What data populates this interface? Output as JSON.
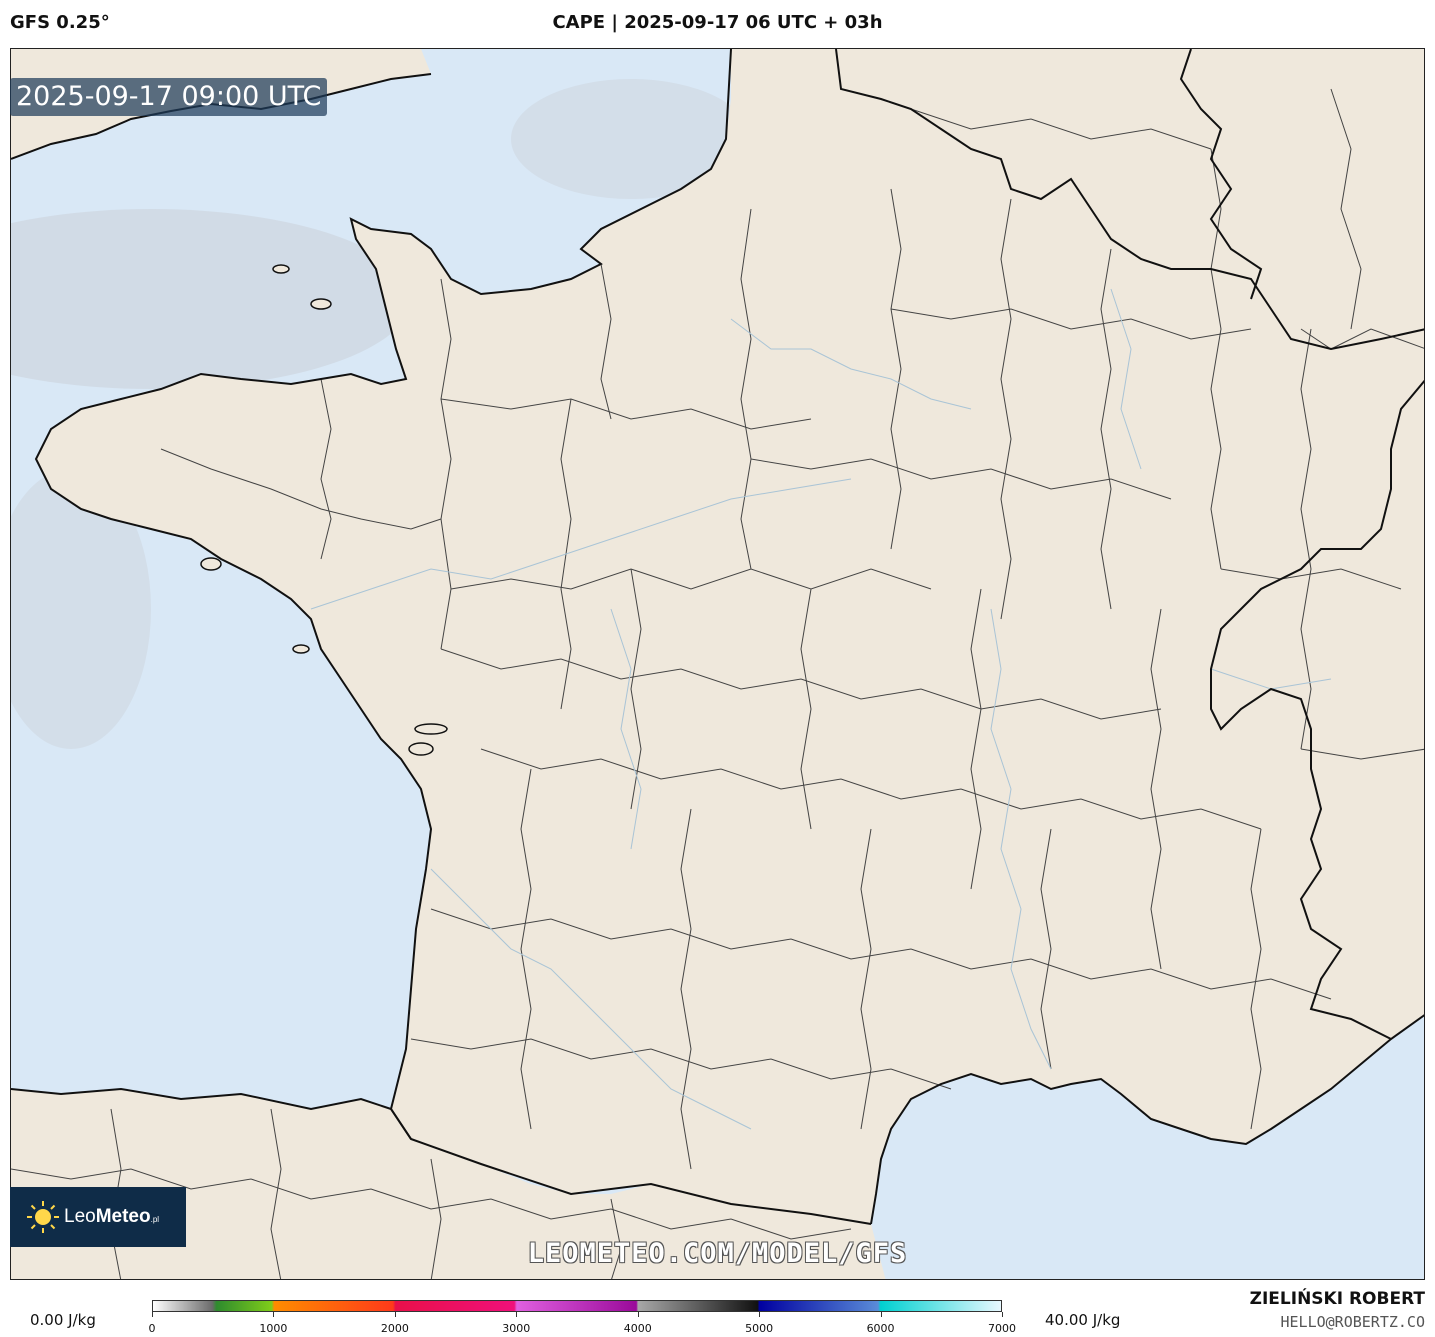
{
  "header": {
    "model": "GFS 0.25°",
    "title": "CAPE | 2025-09-17 06 UTC + 03h"
  },
  "map": {
    "timestamp": "2025-09-17 09:00 UTC",
    "watermark": "LEOMETEO.COM/MODEL/GFS",
    "colors": {
      "sea": "#d9e8f6",
      "land": "#efe8dc",
      "border": "#111111",
      "region_border": "#444444",
      "river": "#a9c4d6"
    }
  },
  "logo": {
    "brand": "LeoMeteo",
    "brand_prefix": "Leo",
    "brand_suffix": "Meteo",
    "tld": ".pl",
    "icon": "sun-icon"
  },
  "legend": {
    "min_label": "0.00 J/kg",
    "max_label": "40.00 J/kg",
    "ticks": [
      "0",
      "1000",
      "2000",
      "3000",
      "4000",
      "5000",
      "6000",
      "7000"
    ],
    "range": [
      0,
      7000
    ]
  },
  "credits": {
    "author": "ZIELIŃSKI ROBERT",
    "email": "HELLO@ROBERTZ.CO"
  }
}
